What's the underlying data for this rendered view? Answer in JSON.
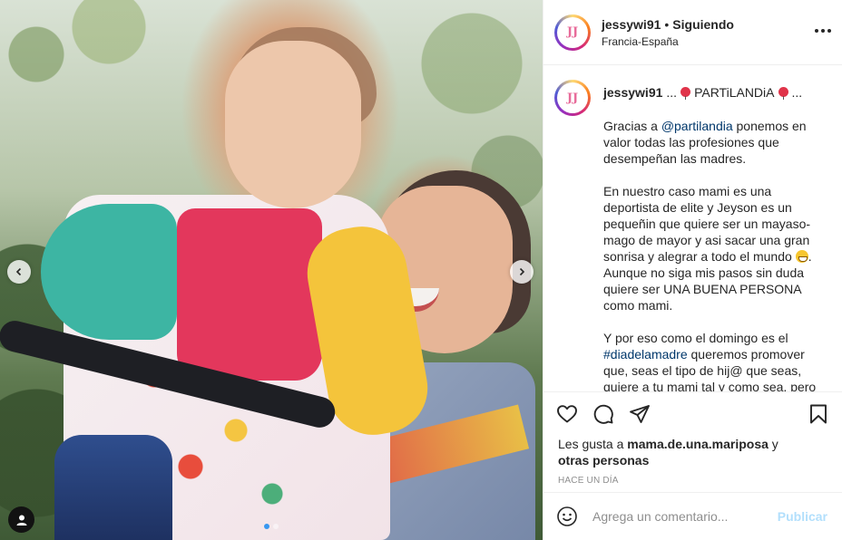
{
  "header": {
    "username": "jessywi91",
    "separator": "•",
    "follow_status": "Siguiendo",
    "location": "Francia-España",
    "avatar_text": "JJ"
  },
  "caption": {
    "username": "jessywi91",
    "ellipsis": "...",
    "title": "PARTiLANDiA",
    "title_ellipsis": "...",
    "p1_mention": "@partilandia",
    "p1_rest": " ponemos en valor todas las profesiones que desempeñan las madres.",
    "p1_lead": "Gracias a ",
    "p2_text": "En nuestro caso mami es una deportista de elite y Jeyson es un pequeñin que quiere ser un mayaso-mago de mayor y asi sacar una gran sonrisa y alegrar a todo el mundo ",
    "p2_after": ". Aunque no siga mis pasos sin duda quiere ser UNA BUENA PERSONA como mami.",
    "p3_lead": "Y por eso como el domingo es el ",
    "p3_hashtag": "#diadelamadre",
    "p3_rest": " queremos promover que, seas el tipo de hij@ que seas, quiere a tu mami tal y como sea, pero"
  },
  "likes": {
    "lead": "Les gusta a ",
    "user": "mama.de.una.mariposa",
    "and": " y",
    "others": "otras personas"
  },
  "timestamp": "HACE UN DÍA",
  "comment_box": {
    "placeholder": "Agrega un comentario...",
    "publish_label": "Publicar"
  },
  "icons": {
    "like": "heart-icon",
    "comment": "comment-icon",
    "share": "paper-plane-icon",
    "save": "bookmark-icon",
    "emoji": "smiley-icon",
    "more": "more-dots-icon",
    "prev": "chevron-left-icon",
    "next": "chevron-right-icon",
    "tag": "user-tag-icon"
  },
  "colors": {
    "link": "#00376b",
    "publish_disabled": "#b2dffc",
    "carousel_active_dot": "#3897f0"
  },
  "carousel": {
    "slides": 2,
    "active": 1
  }
}
